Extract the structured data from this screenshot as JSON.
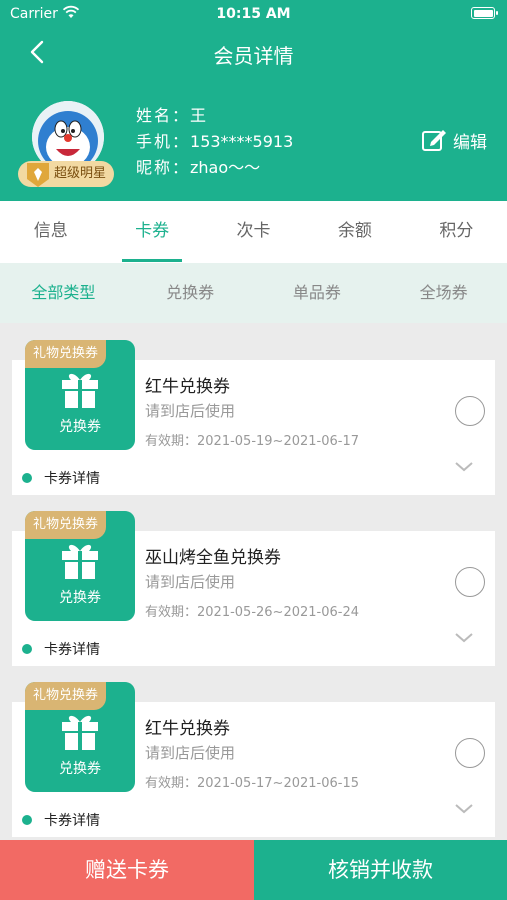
{
  "status_bar": {
    "carrier": "Carrier",
    "time": "10:15 AM"
  },
  "nav": {
    "title": "会员详情"
  },
  "profile": {
    "name_label": "姓名：",
    "name_value": "王",
    "phone_label": "手机：",
    "phone_value": "153****5913",
    "nick_label": "昵称：",
    "nick_value": "zhao～～",
    "badge": "超级明星",
    "edit_label": "编辑"
  },
  "tabs": [
    {
      "label": "信息"
    },
    {
      "label": "卡券"
    },
    {
      "label": "次卡"
    },
    {
      "label": "余额"
    },
    {
      "label": "积分"
    }
  ],
  "active_tab": "卡券",
  "subtabs": [
    {
      "label": "全部类型"
    },
    {
      "label": "兑换券"
    },
    {
      "label": "单品券"
    },
    {
      "label": "全场券"
    }
  ],
  "active_subtab": "全部类型",
  "coupons": [
    {
      "tag": "礼物兑换券",
      "thumb_label": "兑换券",
      "title": "红牛兑换券",
      "subtitle": "请到店后使用",
      "validity": "有效期：2021-05-19~2021-06-17",
      "detail": "卡券详情"
    },
    {
      "tag": "礼物兑换券",
      "thumb_label": "兑换券",
      "title": "巫山烤全鱼兑换券",
      "subtitle": "请到店后使用",
      "validity": "有效期：2021-05-26~2021-06-24",
      "detail": "卡券详情"
    },
    {
      "tag": "礼物兑换券",
      "thumb_label": "兑换券",
      "title": "红牛兑换券",
      "subtitle": "请到店后使用",
      "validity": "有效期：2021-05-17~2021-06-15",
      "detail": "卡券详情"
    }
  ],
  "bottom": {
    "gift_label": "赠送卡券",
    "pay_label": "核销并收款"
  },
  "colors": {
    "primary": "#1cb18e",
    "danger": "#f26a64",
    "tag": "#d9b573",
    "badge": "#f2d9a2"
  }
}
